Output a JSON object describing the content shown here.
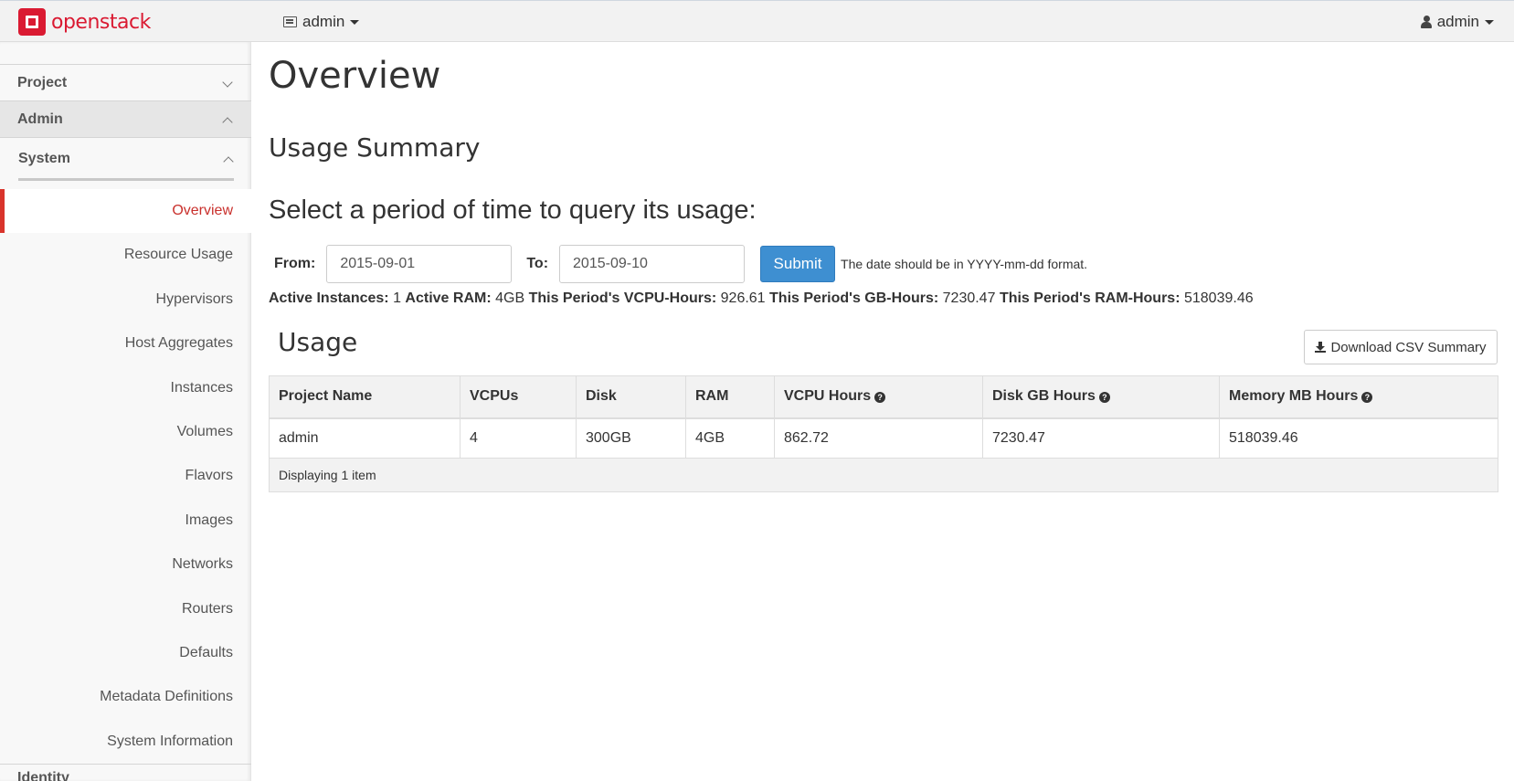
{
  "brand": {
    "name": "openstack",
    "color": "#da1a32"
  },
  "header": {
    "project_menu": "admin",
    "user_menu": "admin"
  },
  "sidebar": {
    "groups": {
      "project": "Project",
      "admin": "Admin",
      "system": "System",
      "identity": "Identity"
    },
    "items": [
      {
        "label": "Overview",
        "active": true
      },
      {
        "label": "Resource Usage"
      },
      {
        "label": "Hypervisors"
      },
      {
        "label": "Host Aggregates"
      },
      {
        "label": "Instances"
      },
      {
        "label": "Volumes"
      },
      {
        "label": "Flavors"
      },
      {
        "label": "Images"
      },
      {
        "label": "Networks"
      },
      {
        "label": "Routers"
      },
      {
        "label": "Defaults"
      },
      {
        "label": "Metadata Definitions"
      },
      {
        "label": "System Information"
      }
    ]
  },
  "main": {
    "title": "Overview",
    "summary_title": "Usage Summary",
    "query_heading": "Select a period of time to query its usage:",
    "form": {
      "from_label": "From:",
      "from_value": "2015-09-01",
      "to_label": "To:",
      "to_value": "2015-09-10",
      "submit_label": "Submit",
      "hint": "The date should be in YYYY-mm-dd format."
    },
    "stats": {
      "active_instances_label": "Active Instances:",
      "active_instances": "1",
      "active_ram_label": "Active RAM:",
      "active_ram": "4GB",
      "vcpu_hours_label": "This Period's VCPU-Hours:",
      "vcpu_hours": "926.61",
      "gb_hours_label": "This Period's GB-Hours:",
      "gb_hours": "7230.47",
      "ram_hours_label": "This Period's RAM-Hours:",
      "ram_hours": "518039.46"
    },
    "usage_title": "Usage",
    "csv_button": "Download CSV Summary",
    "table": {
      "headers": [
        "Project Name",
        "VCPUs",
        "Disk",
        "RAM",
        "VCPU Hours",
        "Disk GB Hours",
        "Memory MB Hours"
      ],
      "rows": [
        [
          "admin",
          "4",
          "300GB",
          "4GB",
          "862.72",
          "7230.47",
          "518039.46"
        ]
      ],
      "footer": "Displaying 1 item"
    }
  }
}
